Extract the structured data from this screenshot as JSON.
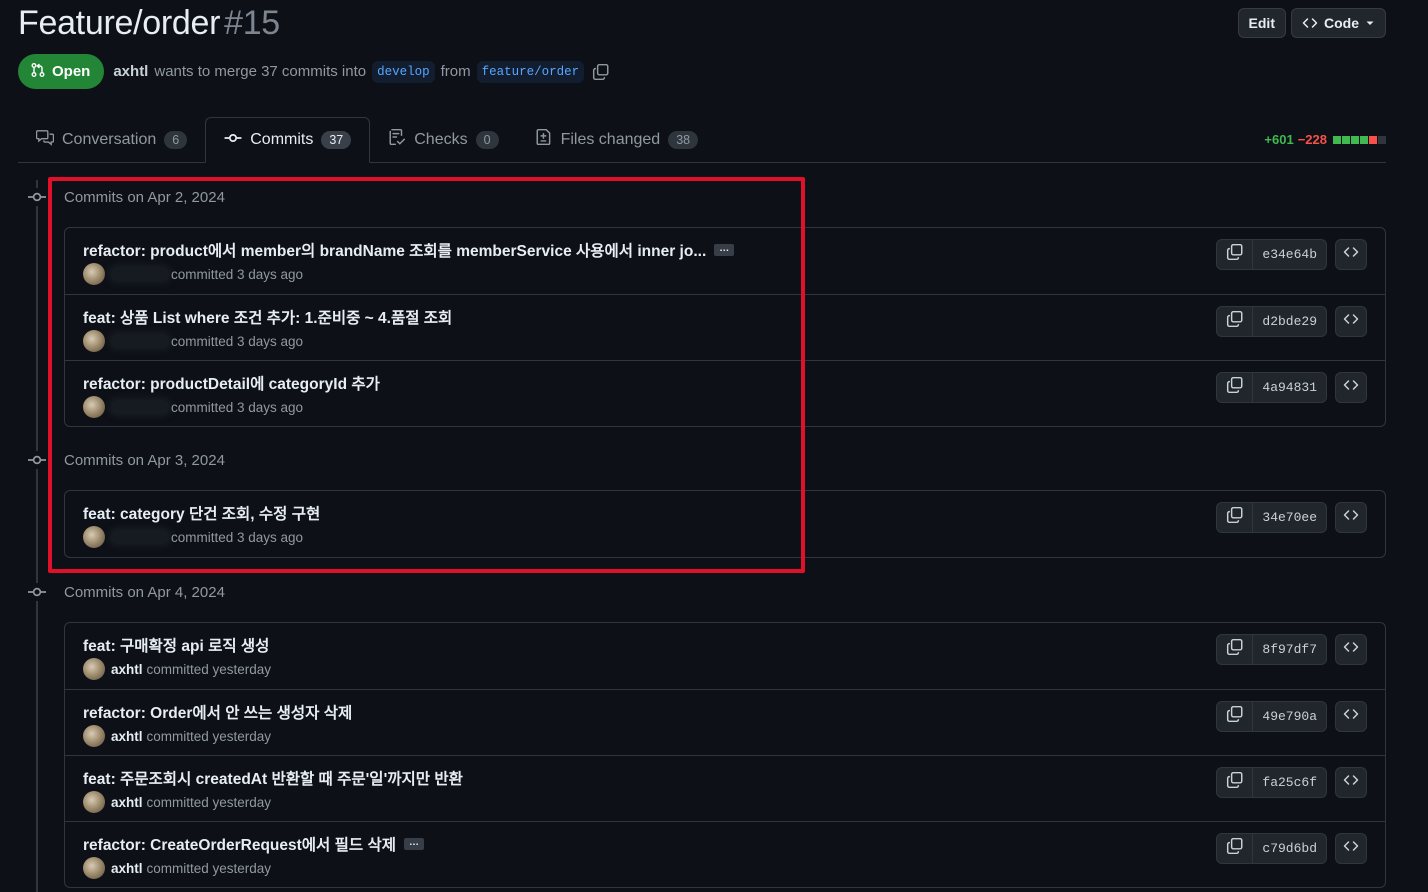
{
  "pr": {
    "title": "Feature/order",
    "number": "#15",
    "state": "Open",
    "author": "axhtl",
    "merge_text": "wants to merge 37 commits into",
    "base_branch": "develop",
    "from_text": "from",
    "head_branch": "feature/order"
  },
  "header_actions": {
    "edit": "Edit",
    "code": "Code"
  },
  "tabs": [
    {
      "label": "Conversation",
      "count": "6",
      "icon": "comment-discussion-icon"
    },
    {
      "label": "Commits",
      "count": "37",
      "icon": "git-commit-icon",
      "active": true
    },
    {
      "label": "Checks",
      "count": "0",
      "icon": "checklist-icon"
    },
    {
      "label": "Files changed",
      "count": "38",
      "icon": "file-diff-icon"
    }
  ],
  "diffstat": {
    "additions": "+601",
    "deletions": "−228",
    "blocks": [
      "#3fb950",
      "#3fb950",
      "#3fb950",
      "#3fb950",
      "#f85149"
    ]
  },
  "colors": {
    "accent_green": "#238636",
    "highlight_red": "#e0102a",
    "link_blue": "#58a6ff"
  },
  "groups": [
    {
      "date": "Commits on Apr 2, 2024",
      "commits": [
        {
          "message": "refactor: product에서 member의 brandName 조회를 memberService 사용에서 inner jo...",
          "truncated": true,
          "author": "",
          "time": "committed 3 days ago",
          "sha": "e34e64b"
        },
        {
          "message": "feat: 상품 List where 조건 추가: 1.준비중 ~ 4.품절 조회",
          "author": "",
          "time": "committed 3 days ago",
          "sha": "d2bde29"
        },
        {
          "message": "refactor: productDetail에 categoryId 추가",
          "author": "",
          "time": "committed 3 days ago",
          "sha": "4a94831"
        }
      ]
    },
    {
      "date": "Commits on Apr 3, 2024",
      "commits": [
        {
          "message": "feat: category 단건 조회, 수정 구현",
          "author": "",
          "time": "committed 3 days ago",
          "sha": "34e70ee"
        }
      ]
    },
    {
      "date": "Commits on Apr 4, 2024",
      "commits": [
        {
          "message": "feat: 구매확정 api 로직 생성",
          "author": "axhtl",
          "time": "committed yesterday",
          "sha": "8f97df7"
        },
        {
          "message": "refactor: Order에서 안 쓰는 생성자 삭제",
          "author": "axhtl",
          "time": "committed yesterday",
          "sha": "49e790a"
        },
        {
          "message": "feat: 주문조회시 createdAt 반환할 때 주문'일'까지만 반환",
          "author": "axhtl",
          "time": "committed yesterday",
          "sha": "fa25c6f"
        },
        {
          "message": "refactor: CreateOrderRequest에서 필드 삭제",
          "truncated": true,
          "author": "axhtl",
          "time": "committed yesterday",
          "sha": "c79d6bd"
        }
      ]
    }
  ],
  "ellipsis_label": "…"
}
